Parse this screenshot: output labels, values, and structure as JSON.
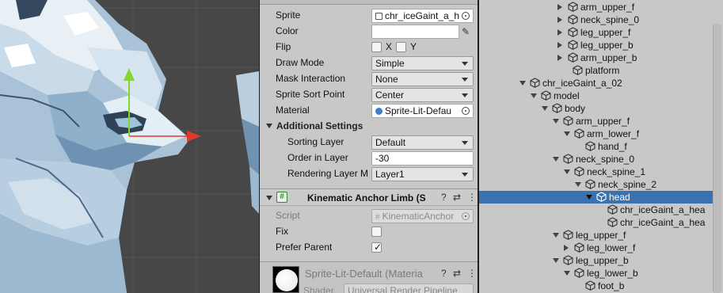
{
  "inspector": {
    "sprite_renderer": {
      "sprite_label": "Sprite",
      "sprite_value": "chr_iceGaint_a_h",
      "color_label": "Color",
      "flip_label": "Flip",
      "flip_x": "X",
      "flip_y": "Y",
      "draw_mode_label": "Draw Mode",
      "draw_mode_value": "Simple",
      "mask_label": "Mask Interaction",
      "mask_value": "None",
      "sort_point_label": "Sprite Sort Point",
      "sort_point_value": "Center",
      "material_label": "Material",
      "material_value": "Sprite-Lit-Defau"
    },
    "additional": {
      "header": "Additional Settings",
      "sorting_layer_label": "Sorting Layer",
      "sorting_layer_value": "Default",
      "order_label": "Order in Layer",
      "order_value": "-30",
      "rendering_layer_label": "Rendering Layer M",
      "rendering_layer_value": "Layer1"
    },
    "kinematic": {
      "title": "Kinematic Anchor Limb (S",
      "script_label": "Script",
      "script_value": "KinematicAnchor",
      "fix_label": "Fix",
      "fix_checked": false,
      "prefer_label": "Prefer Parent",
      "prefer_checked": true
    },
    "material_preview": {
      "name": "Sprite-Lit-Default (Materia",
      "shader_label": "Shader",
      "shader_value": "Universal Render Pipeline"
    }
  },
  "hierarchy": {
    "items": [
      {
        "label": "arm_upper_f",
        "arrow": "right"
      },
      {
        "label": "neck_spine_0",
        "arrow": "right"
      },
      {
        "label": "leg_upper_f",
        "arrow": "right"
      },
      {
        "label": "leg_upper_b",
        "arrow": "right"
      },
      {
        "label": "arm_upper_b",
        "arrow": "right"
      },
      {
        "label": "platform",
        "arrow": ""
      },
      {
        "label": "chr_iceGaint_a_02",
        "arrow": "down"
      },
      {
        "label": "model",
        "arrow": "down"
      },
      {
        "label": "body",
        "arrow": "down"
      },
      {
        "label": "arm_upper_f",
        "arrow": "down"
      },
      {
        "label": "arm_lower_f",
        "arrow": "down"
      },
      {
        "label": "hand_f",
        "arrow": ""
      },
      {
        "label": "neck_spine_0",
        "arrow": "down"
      },
      {
        "label": "neck_spine_1",
        "arrow": "down"
      },
      {
        "label": "neck_spine_2",
        "arrow": "down"
      },
      {
        "label": "head",
        "arrow": "down",
        "selected": true
      },
      {
        "label": "chr_iceGaint_a_hea",
        "arrow": ""
      },
      {
        "label": "chr_iceGaint_a_hea",
        "arrow": ""
      },
      {
        "label": "leg_upper_f",
        "arrow": "down"
      },
      {
        "label": "leg_lower_f",
        "arrow": "right"
      },
      {
        "label": "leg_upper_b",
        "arrow": "down"
      },
      {
        "label": "leg_lower_b",
        "arrow": "down"
      },
      {
        "label": "foot_b",
        "arrow": ""
      }
    ]
  },
  "colors": {
    "selection": "#3a72b0",
    "gizmo_up": "#7fd82a",
    "gizmo_right": "#e23a2a"
  }
}
